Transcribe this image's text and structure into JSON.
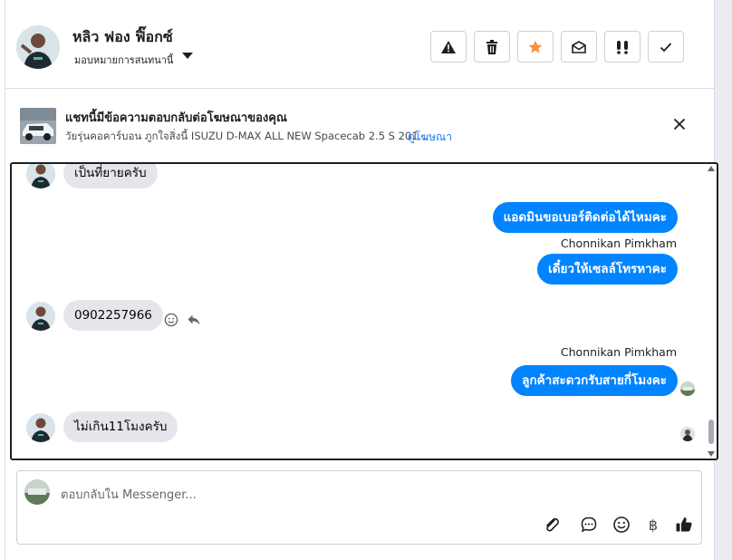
{
  "header": {
    "contact_name": "หลิว ฟอง ฟิ๊อกซ์",
    "assign_label": "มอบหมายการสนทนานี้",
    "tools": [
      "warning-icon",
      "trash-icon",
      "star-icon",
      "mark-unread-icon",
      "spam-icon",
      "done-icon"
    ],
    "star_color": "#f7923b"
  },
  "ad_banner": {
    "title": "แชทนี้มีข้อความตอบกลับต่อโฆษณาของคุณ",
    "subtitle": "วัยรุ่นคอคาร์บอน ภูกใจสิ่งนี้ ISUZU D-MAX ALL NEW Spacecab 2.5 S 201...",
    "link": "ดูโฆษณา"
  },
  "messages": [
    {
      "direction": "in",
      "text": "เป็นที่ยายครับ"
    },
    {
      "direction": "out",
      "text": "แอดมินขอเบอร์ติดต่อได้ไหมคะ"
    },
    {
      "direction": "out",
      "sender": "Chonnikan Pimkham",
      "text": "เดี๋ยวให้เซลล์โทรหาคะ"
    },
    {
      "direction": "in",
      "text": "0902257966"
    },
    {
      "direction": "out",
      "sender": "Chonnikan Pimkham",
      "text": "ลูกค้าสะดวกรับสายกี่โมงคะ"
    },
    {
      "direction": "in",
      "text": "ไม่เกิน11โมงครับ"
    }
  ],
  "composer": {
    "placeholder": "ตอบกลับใน Messenger...",
    "tools": [
      "attach-icon",
      "saved-reply-icon",
      "emoji-icon",
      "baht-icon",
      "thumbs-up-icon"
    ],
    "baht_symbol": "฿"
  },
  "colors": {
    "outgoing_bubble": "#0084ff",
    "incoming_bubble": "#e4e6eb",
    "link": "#1877f2"
  }
}
